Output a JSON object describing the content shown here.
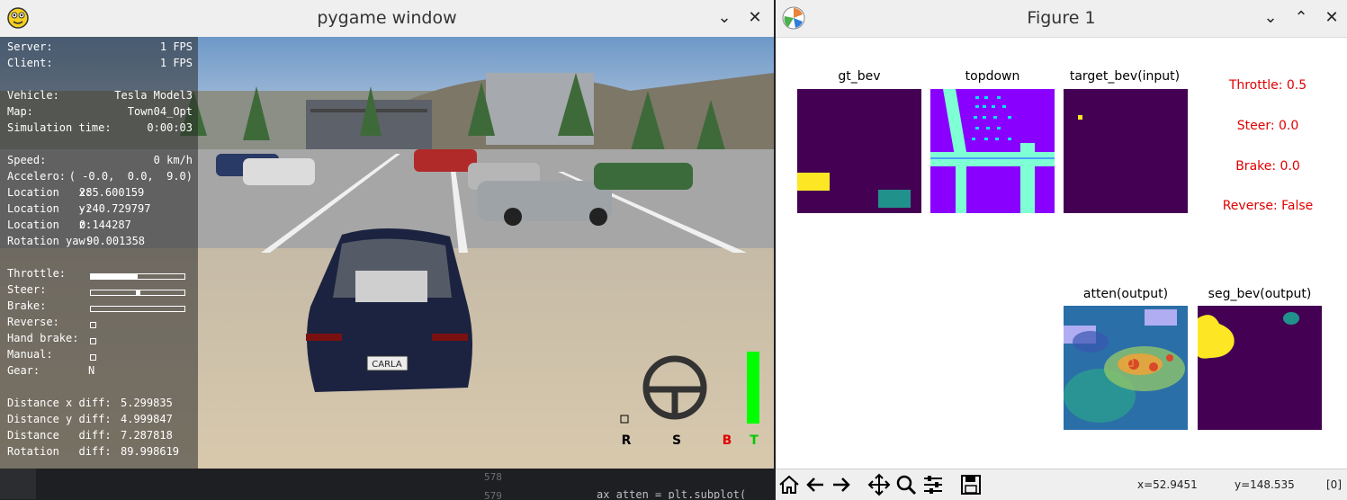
{
  "pygame": {
    "title": "pygame window",
    "hud": {
      "server_label": "Server:",
      "server_value": "1 FPS",
      "client_label": "Client:",
      "client_value": "1 FPS",
      "vehicle_label": "Vehicle:",
      "vehicle_value": "Tesla Model3",
      "map_label": "Map:",
      "map_value": "Town04_Opt",
      "simtime_label": "Simulation time:",
      "simtime_value": "0:00:03",
      "speed_label": "Speed:",
      "speed_value": "0 km/h",
      "accel_label": "Accelero:",
      "accel_value": "( -0.0,  0.0,  9.0)",
      "locx_label": "Location   x:",
      "locx_value": "285.600159",
      "locy_label": "Location   y:",
      "locy_value": "-240.729797",
      "locz_label": "Location   z:",
      "locz_value": "0.144287",
      "rot_label": "Rotation yaw:",
      "rot_value": "90.001358",
      "throttle_label": "Throttle:",
      "throttle_level": 0.5,
      "steer_label": "Steer:",
      "steer_level": 0.5,
      "brake_label": "Brake:",
      "brake_level": 0.0,
      "reverse_label": "Reverse:",
      "handbrake_label": "Hand brake:",
      "manual_label": "Manual:",
      "gear_label": "Gear:",
      "gear_value": "N",
      "dx_label": "Distance x diff:",
      "dx_value": "5.299835",
      "dy_label": "Distance y diff:",
      "dy_value": "4.999847",
      "dist_label": "Distance   diff:",
      "dist_value": "7.287818",
      "rotd_label": "Rotation   diff:",
      "rotd_value": "89.998619"
    },
    "car_plate": "CARLA",
    "pedals": {
      "r": "R",
      "s": "S",
      "b": "B",
      "t": "T"
    }
  },
  "figure": {
    "title": "Figure 1",
    "panels": {
      "gt_bev": "gt_bev",
      "topdown": "topdown",
      "target_bev": "target_bev(input)",
      "atten": "atten(output)",
      "seg_bev": "seg_bev(output)"
    },
    "controls": {
      "throttle": "Throttle: 0.5",
      "steer": "Steer: 0.0",
      "brake": "Brake: 0.0",
      "reverse": "Reverse: False"
    },
    "coords": {
      "x": "x=52.9451",
      "y": "y=148.535",
      "val": "[0]"
    }
  },
  "editor": {
    "line1": "578",
    "line2": "579",
    "code": "ax_atten = plt.subplot("
  },
  "colors": {
    "bev_bg": "#440154",
    "bev_yellow": "#fde725",
    "bev_teal": "#21918c",
    "topdown_bg": "#8a00ff",
    "topdown_road": "#7fffd4",
    "control_red": "#e00000",
    "throttle_green": "#00ff00"
  }
}
